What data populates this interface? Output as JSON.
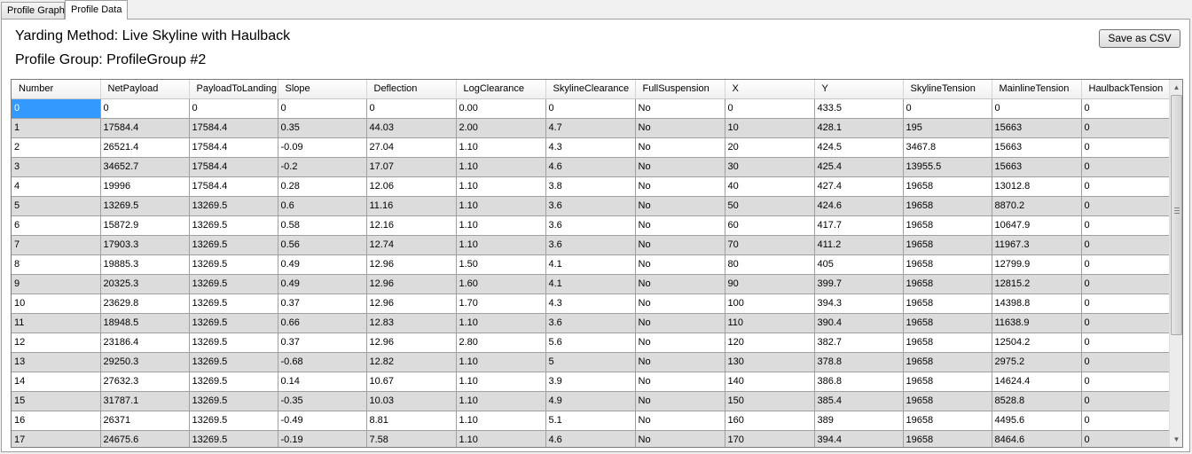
{
  "tabs": [
    {
      "label": "Profile Graph",
      "active": false
    },
    {
      "label": "Profile Data",
      "active": true
    }
  ],
  "header": {
    "yarding_method": "Yarding Method: Live Skyline with Haulback",
    "profile_group": "Profile Group: ProfileGroup #2"
  },
  "toolbar": {
    "save_csv_label": "Save as CSV"
  },
  "grid": {
    "columns": [
      "Number",
      "NetPayload",
      "PayloadToLanding",
      "Slope",
      "Deflection",
      "LogClearance",
      "SkylineClearance",
      "FullSuspension",
      "X",
      "Y",
      "SkylineTension",
      "MainlineTension",
      "HaulbackTension"
    ],
    "rows": [
      [
        "0",
        "0",
        "0",
        "0",
        "0",
        "0.00",
        "0",
        "No",
        "0",
        "433.5",
        "0",
        "0",
        "0"
      ],
      [
        "1",
        "17584.4",
        "17584.4",
        "0.35",
        "44.03",
        "2.00",
        "4.7",
        "No",
        "10",
        "428.1",
        "195",
        "15663",
        "0"
      ],
      [
        "2",
        "26521.4",
        "17584.4",
        "-0.09",
        "27.04",
        "1.10",
        "4.3",
        "No",
        "20",
        "424.5",
        "3467.8",
        "15663",
        "0"
      ],
      [
        "3",
        "34652.7",
        "17584.4",
        "-0.2",
        "17.07",
        "1.10",
        "4.6",
        "No",
        "30",
        "425.4",
        "13955.5",
        "15663",
        "0"
      ],
      [
        "4",
        "19996",
        "17584.4",
        "0.28",
        "12.06",
        "1.10",
        "3.8",
        "No",
        "40",
        "427.4",
        "19658",
        "13012.8",
        "0"
      ],
      [
        "5",
        "13269.5",
        "13269.5",
        "0.6",
        "11.16",
        "1.10",
        "3.6",
        "No",
        "50",
        "424.6",
        "19658",
        "8870.2",
        "0"
      ],
      [
        "6",
        "15872.9",
        "13269.5",
        "0.58",
        "12.16",
        "1.10",
        "3.6",
        "No",
        "60",
        "417.7",
        "19658",
        "10647.9",
        "0"
      ],
      [
        "7",
        "17903.3",
        "13269.5",
        "0.56",
        "12.74",
        "1.10",
        "3.6",
        "No",
        "70",
        "411.2",
        "19658",
        "11967.3",
        "0"
      ],
      [
        "8",
        "19885.3",
        "13269.5",
        "0.49",
        "12.96",
        "1.50",
        "4.1",
        "No",
        "80",
        "405",
        "19658",
        "12799.9",
        "0"
      ],
      [
        "9",
        "20325.3",
        "13269.5",
        "0.49",
        "12.96",
        "1.60",
        "4.1",
        "No",
        "90",
        "399.7",
        "19658",
        "12815.2",
        "0"
      ],
      [
        "10",
        "23629.8",
        "13269.5",
        "0.37",
        "12.96",
        "1.70",
        "4.3",
        "No",
        "100",
        "394.3",
        "19658",
        "14398.8",
        "0"
      ],
      [
        "11",
        "18948.5",
        "13269.5",
        "0.66",
        "12.83",
        "1.10",
        "3.6",
        "No",
        "110",
        "390.4",
        "19658",
        "11638.9",
        "0"
      ],
      [
        "12",
        "23186.4",
        "13269.5",
        "0.37",
        "12.96",
        "2.80",
        "5.6",
        "No",
        "120",
        "382.7",
        "19658",
        "12504.2",
        "0"
      ],
      [
        "13",
        "29250.3",
        "13269.5",
        "-0.68",
        "12.82",
        "1.10",
        "5",
        "No",
        "130",
        "378.8",
        "19658",
        "2975.2",
        "0"
      ],
      [
        "14",
        "27632.3",
        "13269.5",
        "0.14",
        "10.67",
        "1.10",
        "3.9",
        "No",
        "140",
        "386.8",
        "19658",
        "14624.4",
        "0"
      ],
      [
        "15",
        "31787.1",
        "13269.5",
        "-0.35",
        "10.03",
        "1.10",
        "4.9",
        "No",
        "150",
        "385.4",
        "19658",
        "8528.8",
        "0"
      ],
      [
        "16",
        "26371",
        "13269.5",
        "-0.49",
        "8.81",
        "1.10",
        "5.1",
        "No",
        "160",
        "389",
        "19658",
        "4495.6",
        "0"
      ],
      [
        "17",
        "24675.6",
        "13269.5",
        "-0.19",
        "7.58",
        "1.10",
        "4.6",
        "No",
        "170",
        "394.4",
        "19658",
        "8464.6",
        "0"
      ]
    ]
  },
  "icons": {
    "scroll_up": "scroll-up-arrow-icon",
    "scroll_down": "scroll-down-arrow-icon"
  }
}
